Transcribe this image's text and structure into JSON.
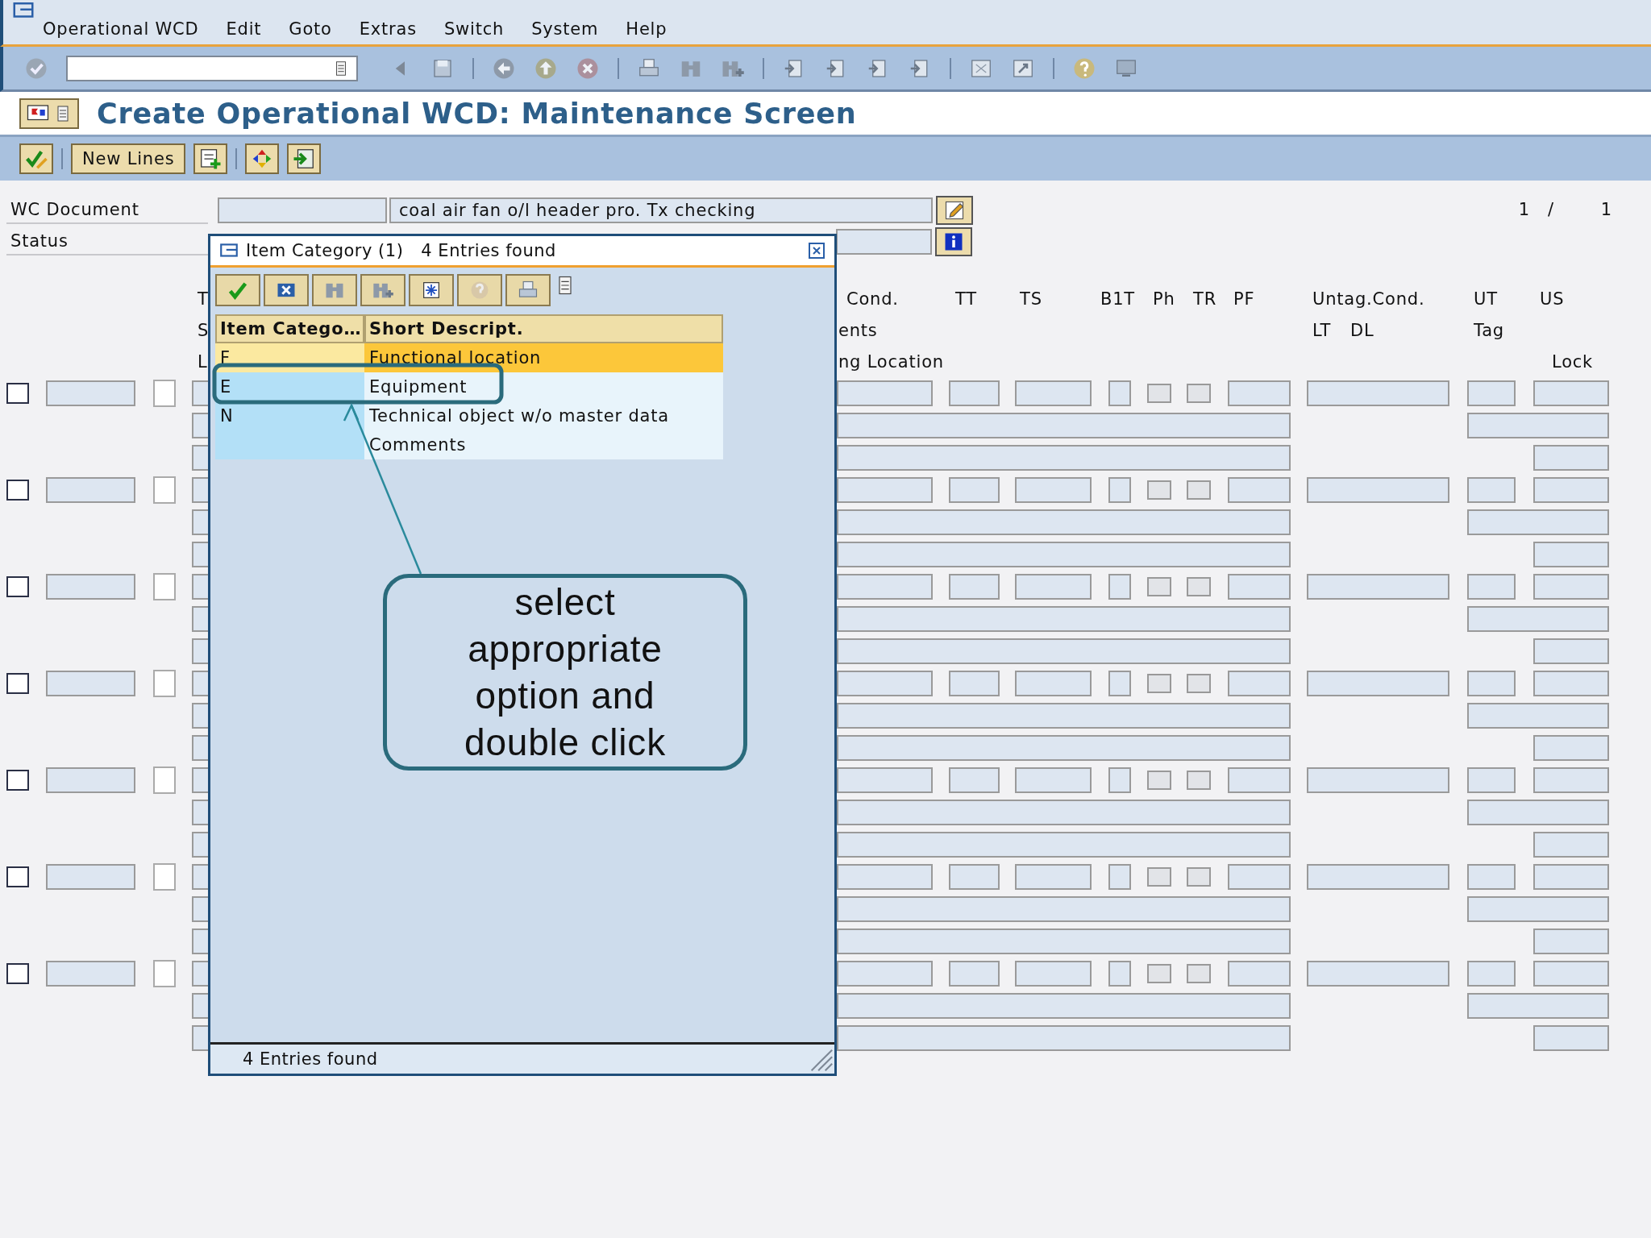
{
  "menu_bar": [
    "Operational WCD",
    "Edit",
    "Goto",
    "Extras",
    "Switch",
    "System",
    "Help"
  ],
  "title": "Create Operational WCD: Maintenance Screen",
  "app_toolbar": {
    "button": "New Lines"
  },
  "header_fields": [
    {
      "label": "WC Document",
      "description": "coal air fan o/l header pro. Tx checking"
    },
    {
      "label": "Status"
    }
  ],
  "page_counter": {
    "current": "1",
    "separator": "/",
    "total": "1"
  },
  "column_headers": [
    [
      "T",
      "Cond.",
      "TT",
      "TS",
      "B1T",
      "Ph",
      "TR",
      "PF",
      "Untag.Cond.",
      "UT",
      "US"
    ],
    [
      "S",
      "ents",
      "LT",
      "DL",
      "Tag"
    ],
    [
      "L",
      "ng Location",
      "Lock"
    ]
  ],
  "rows": [
    {
      "checked": false,
      "ph": false,
      "tr": false
    },
    {
      "checked": false,
      "ph": false,
      "tr": false
    },
    {
      "checked": false,
      "ph": false,
      "tr": false
    },
    {
      "checked": false,
      "ph": false,
      "tr": false
    },
    {
      "checked": false,
      "ph": false,
      "tr": false
    },
    {
      "checked": false,
      "ph": false,
      "tr": false
    },
    {
      "checked": false,
      "ph": false,
      "tr": false
    }
  ],
  "popup": {
    "title": "Item Category (1)",
    "subtitle": "4 Entries found",
    "columns": [
      "Item Catego…",
      "Short Descript."
    ],
    "rows": [
      {
        "code": "F",
        "description": "Functional location",
        "selected": true
      },
      {
        "code": "E",
        "description": "Equipment",
        "selected": false
      },
      {
        "code": "N",
        "description": "Technical object w/o master data",
        "selected": false
      },
      {
        "description": "Comments",
        "selected": false
      }
    ],
    "status": "4 Entries found"
  },
  "callout": {
    "text": "select appropriate option and double click"
  }
}
